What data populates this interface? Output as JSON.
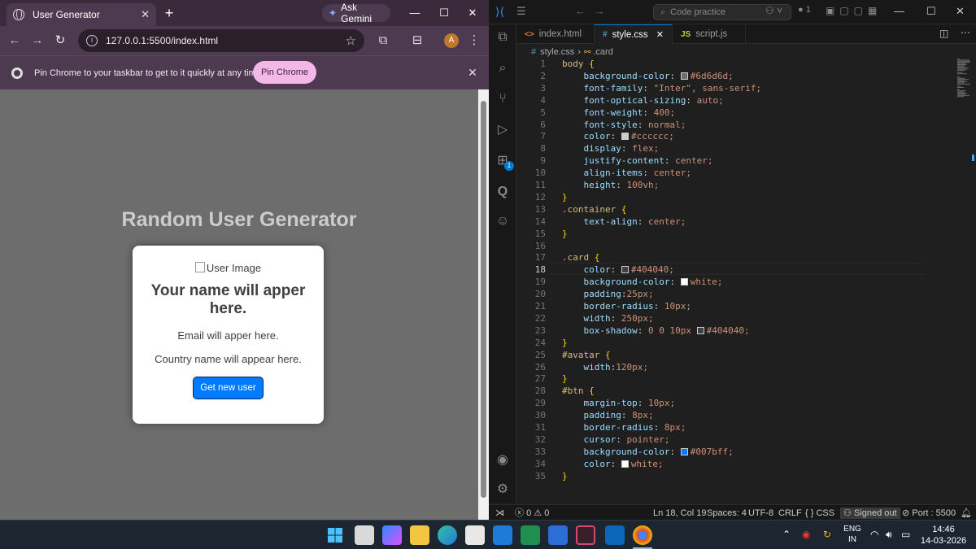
{
  "chrome": {
    "tab_title": "User Generator",
    "tab_close": "✕",
    "new_tab": "+",
    "gemini_label": "Ask Gemini",
    "url": "127.0.0.1:5500/index.html",
    "avatar_letter": "A",
    "pin_message": "Pin Chrome to your taskbar to get to it quickly at any time",
    "pin_button": "Pin Chrome",
    "pin_close": "✕"
  },
  "page": {
    "title": "Random User Generator",
    "image_alt": "User Image",
    "name": "Your name will apper here.",
    "email": "Email will apper here.",
    "country": "Country name will appear here.",
    "button": "Get new user"
  },
  "vscode": {
    "search_placeholder": "Code practice",
    "tabs": [
      {
        "icon": "<>",
        "label": "index.html"
      },
      {
        "icon": "#",
        "label": "style.css",
        "close": "✕"
      },
      {
        "icon": "JS",
        "label": "script.js"
      }
    ],
    "breadcrumb": [
      "style.css",
      ".card"
    ],
    "code_lines": [
      {
        "n": "1",
        "t": "body {"
      },
      {
        "n": "2",
        "t": "    background-color: #6d6d6d;"
      },
      {
        "n": "3",
        "t": "    font-family: \"Inter\", sans-serif;"
      },
      {
        "n": "4",
        "t": "    font-optical-sizing: auto;"
      },
      {
        "n": "5",
        "t": "    font-weight: 400;"
      },
      {
        "n": "6",
        "t": "    font-style: normal;"
      },
      {
        "n": "7",
        "t": "    color: #cccccc;"
      },
      {
        "n": "8",
        "t": "    display: flex;"
      },
      {
        "n": "9",
        "t": "    justify-content: center;"
      },
      {
        "n": "10",
        "t": "    align-items: center;"
      },
      {
        "n": "11",
        "t": "    height: 100vh;"
      },
      {
        "n": "12",
        "t": "}"
      },
      {
        "n": "13",
        "t": ".container {"
      },
      {
        "n": "14",
        "t": "    text-align: center;"
      },
      {
        "n": "15",
        "t": "}"
      },
      {
        "n": "16",
        "t": ""
      },
      {
        "n": "17",
        "t": ".card {"
      },
      {
        "n": "18",
        "t": "    color: #404040;"
      },
      {
        "n": "19",
        "t": "    background-color: white;"
      },
      {
        "n": "20",
        "t": "    padding:25px;"
      },
      {
        "n": "21",
        "t": "    border-radius: 10px;"
      },
      {
        "n": "22",
        "t": "    width: 250px;"
      },
      {
        "n": "23",
        "t": "    box-shadow: 0 0 10px #404040;"
      },
      {
        "n": "24",
        "t": "}"
      },
      {
        "n": "25",
        "t": "#avatar {"
      },
      {
        "n": "26",
        "t": "    width:120px;"
      },
      {
        "n": "27",
        "t": "}"
      },
      {
        "n": "28",
        "t": "#btn {"
      },
      {
        "n": "29",
        "t": "    margin-top: 10px;"
      },
      {
        "n": "30",
        "t": "    padding: 8px;"
      },
      {
        "n": "31",
        "t": "    border-radius: 8px;"
      },
      {
        "n": "32",
        "t": "    cursor: pointer;"
      },
      {
        "n": "33",
        "t": "    background-color: #007bff;"
      },
      {
        "n": "34",
        "t": "    color: white;"
      },
      {
        "n": "35",
        "t": "}"
      }
    ],
    "status": {
      "errors": "0",
      "warnings": "0",
      "position": "Ln 18, Col 19",
      "spaces": "Spaces: 4",
      "encoding": "UTF-8",
      "eol": "CRLF",
      "language": "CSS",
      "account": "Signed out",
      "port": "Port : 5500"
    },
    "extensions_badge": "1"
  },
  "taskbar": {
    "lang_1": "ENG",
    "lang_2": "IN",
    "time": "14:46",
    "date": "14-03-2026"
  },
  "colors": {
    "page_bg": "#6d6d6d",
    "button_blue": "#007bff",
    "chrome_frame": "#3b2a3c",
    "pin_button": "#f3b7e8"
  }
}
